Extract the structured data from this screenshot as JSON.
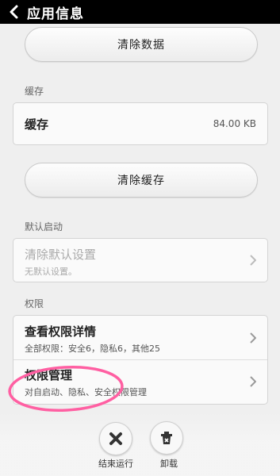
{
  "header": {
    "title": "应用信息"
  },
  "clear_data_button": "清除数据",
  "cache": {
    "section_label": "缓存",
    "row_label": "缓存",
    "size": "84.00 KB",
    "clear_button": "清除缓存"
  },
  "default_launch": {
    "section_label": "默认启动",
    "title": "清除默认设置",
    "subtitle": "无默认设置。"
  },
  "permissions": {
    "section_label": "权限",
    "details_title": "查看权限详情",
    "details_subtitle": "全部权限：安全6，隐私6，其他25",
    "manage_title": "权限管理",
    "manage_subtitle": "对自启动、隐私、安全权限管理"
  },
  "bottom_actions": {
    "force_stop_label": "结束运行",
    "uninstall_label": "卸载"
  },
  "colors": {
    "annotation": "#ff5fa2"
  },
  "icons": [
    "back-arrow-icon",
    "chevron-right-icon",
    "close-x-icon",
    "uninstall-icon"
  ]
}
